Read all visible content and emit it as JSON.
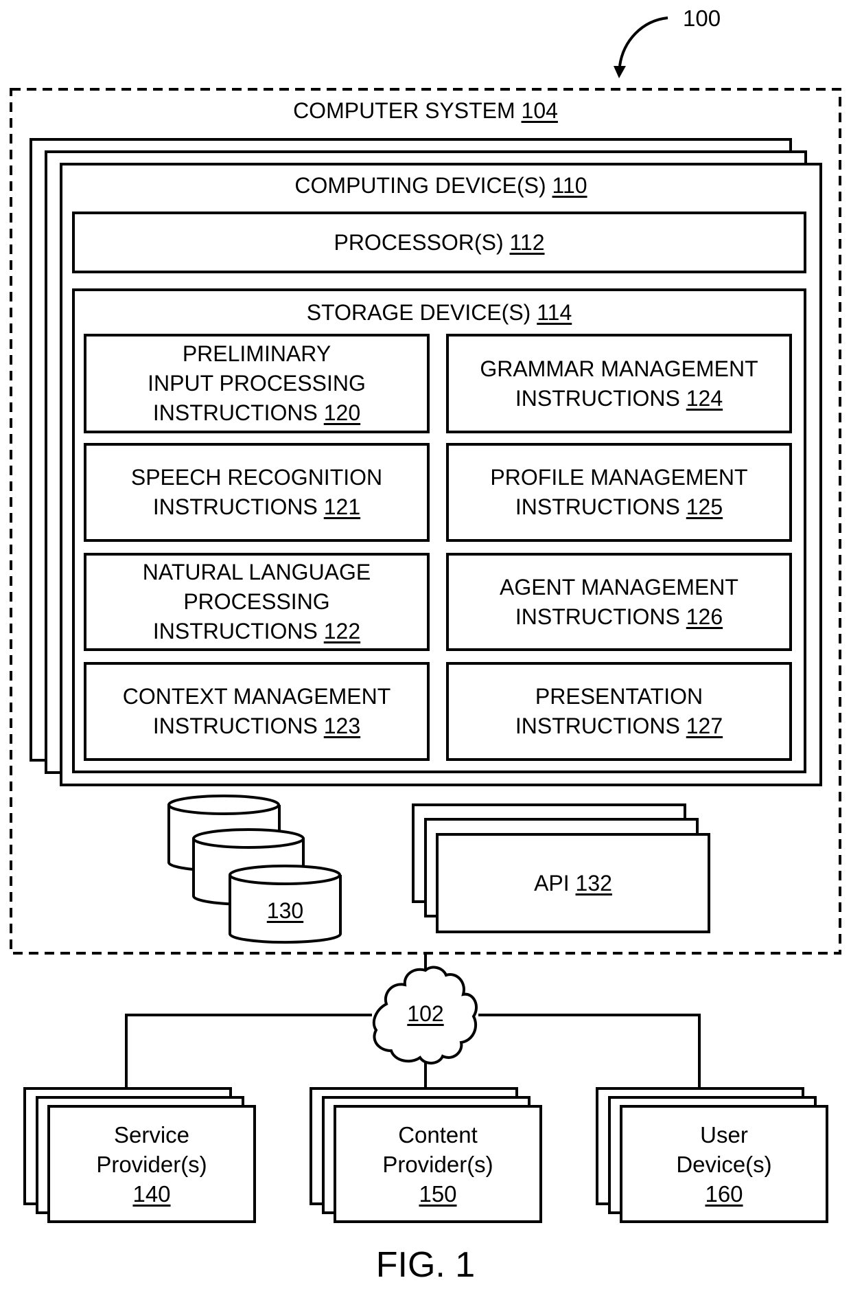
{
  "figure": {
    "title": "FIG. 1",
    "reference_label": "100"
  },
  "computer_system": {
    "label": "COMPUTER SYSTEM",
    "ref": "104",
    "computing_devices": {
      "label": "COMPUTING DEVICE(S)",
      "ref": "110",
      "processors": {
        "label": "PROCESSOR(S)",
        "ref": "112"
      },
      "storage": {
        "label": "STORAGE DEVICE(S)",
        "ref": "114",
        "instructions": [
          {
            "lines": [
              "PRELIMINARY",
              "INPUT PROCESSING",
              "INSTRUCTIONS"
            ],
            "ref": "120"
          },
          {
            "lines": [
              "GRAMMAR MANAGEMENT",
              "INSTRUCTIONS"
            ],
            "ref": "124"
          },
          {
            "lines": [
              "SPEECH RECOGNITION",
              "INSTRUCTIONS"
            ],
            "ref": "121"
          },
          {
            "lines": [
              "PROFILE MANAGEMENT",
              "INSTRUCTIONS"
            ],
            "ref": "125"
          },
          {
            "lines": [
              "NATURAL LANGUAGE",
              "PROCESSING",
              "INSTRUCTIONS"
            ],
            "ref": "122"
          },
          {
            "lines": [
              "AGENT MANAGEMENT",
              "INSTRUCTIONS"
            ],
            "ref": "126"
          },
          {
            "lines": [
              "CONTEXT MANAGEMENT",
              "INSTRUCTIONS"
            ],
            "ref": "123"
          },
          {
            "lines": [
              "PRESENTATION",
              "INSTRUCTIONS"
            ],
            "ref": "127"
          }
        ]
      }
    },
    "database": {
      "ref": "130"
    },
    "api": {
      "label": "API",
      "ref": "132"
    }
  },
  "network": {
    "ref": "102"
  },
  "providers": [
    {
      "line1": "Service",
      "line2": "Provider(s)",
      "ref": "140"
    },
    {
      "line1": "Content",
      "line2": "Provider(s)",
      "ref": "150"
    },
    {
      "line1": "User",
      "line2": "Device(s)",
      "ref": "160"
    }
  ]
}
